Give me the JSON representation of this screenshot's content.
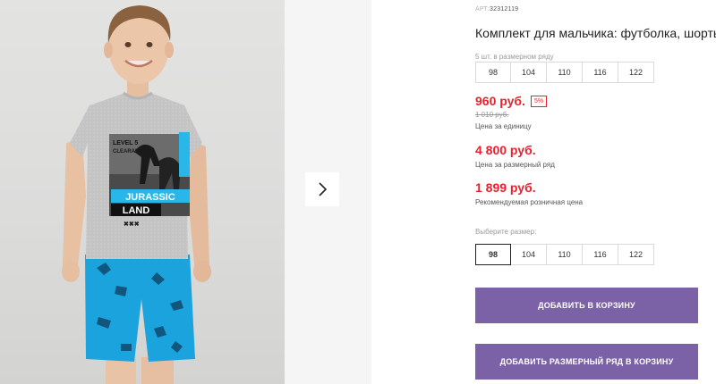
{
  "gallery": {
    "photo_alt_icon": "product-photo",
    "next_icon": "chevron-right-icon",
    "shirt_print": [
      "LEVEL 5",
      "CLEARANCE",
      "JURASSIC",
      "LAND",
      "✖✖✖"
    ]
  },
  "product": {
    "art_label": "АРТ:",
    "art_value": "32312119",
    "title": "Комплект для мальчика: футболка, шорты",
    "row_note": "5 шт. в размерном ряду",
    "row_sizes": [
      "98",
      "104",
      "110",
      "116",
      "122"
    ]
  },
  "prices": {
    "unit_price": "960 руб.",
    "discount": "5%",
    "old_price": "1 010 руб.",
    "unit_caption": "Цена за единицу",
    "row_price": "4 800 руб.",
    "row_caption": "Цена за размерный ряд",
    "retail_price": "1 899 руб.",
    "retail_caption": "Рекомендуемая розничная цена"
  },
  "size_select": {
    "label": "Выберите размер:",
    "options": [
      "98",
      "104",
      "110",
      "116",
      "122"
    ],
    "selected": "98"
  },
  "buttons": {
    "add_to_cart": "ДОБАВИТЬ В КОРЗИНУ",
    "add_row_to_cart": "ДОБАВИТЬ РАЗМЕРНЫЙ РЯД В КОРЗИНУ"
  },
  "colors": {
    "price_red": "#e8222d",
    "button_purple": "#7b62a6",
    "shorts_blue": "#1aa3dd"
  }
}
